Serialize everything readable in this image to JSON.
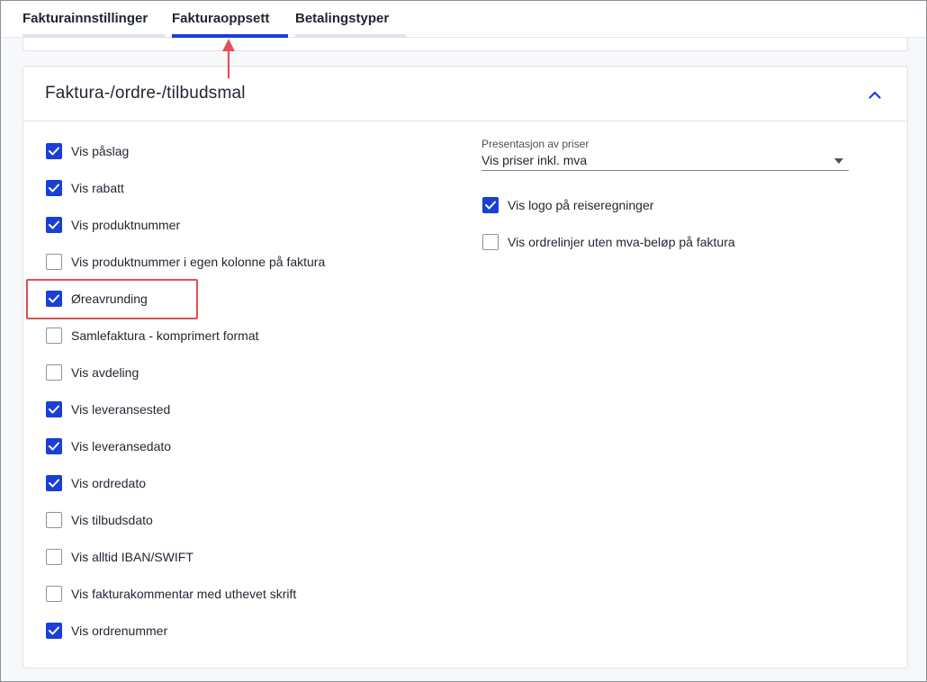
{
  "tabs": [
    {
      "label": "Fakturainnstillinger",
      "active": false
    },
    {
      "label": "Fakturaoppsett",
      "active": true
    },
    {
      "label": "Betalingstyper",
      "active": false
    }
  ],
  "card": {
    "title": "Faktura-/ordre-/tilbudsmal",
    "collapse_icon": "chevron-up-icon"
  },
  "left_checkboxes": [
    {
      "label": "Vis påslag",
      "checked": true
    },
    {
      "label": "Vis rabatt",
      "checked": true
    },
    {
      "label": "Vis produktnummer",
      "checked": true
    },
    {
      "label": "Vis produktnummer i egen kolonne på faktura",
      "checked": false
    },
    {
      "label": "Øreavrunding",
      "checked": true
    },
    {
      "label": "Samlefaktura - komprimert format",
      "checked": false
    },
    {
      "label": "Vis avdeling",
      "checked": false
    },
    {
      "label": "Vis leveransested",
      "checked": true
    },
    {
      "label": "Vis leveransedato",
      "checked": true
    },
    {
      "label": "Vis ordredato",
      "checked": true
    },
    {
      "label": "Vis tilbudsdato",
      "checked": false
    },
    {
      "label": "Vis alltid IBAN/SWIFT",
      "checked": false
    },
    {
      "label": "Vis fakturakommentar med uthevet skrift",
      "checked": false
    },
    {
      "label": "Vis ordrenummer",
      "checked": true
    }
  ],
  "price_select": {
    "label": "Presentasjon av priser",
    "value": "Vis priser inkl. mva"
  },
  "right_checkboxes": [
    {
      "label": "Vis logo på reiseregninger",
      "checked": true
    },
    {
      "label": "Vis ordrelinjer uten mva-beløp på faktura",
      "checked": false
    }
  ],
  "colors": {
    "accent": "#1a3fd8",
    "highlight": "#d9534f",
    "arrow": "#e0525a"
  }
}
